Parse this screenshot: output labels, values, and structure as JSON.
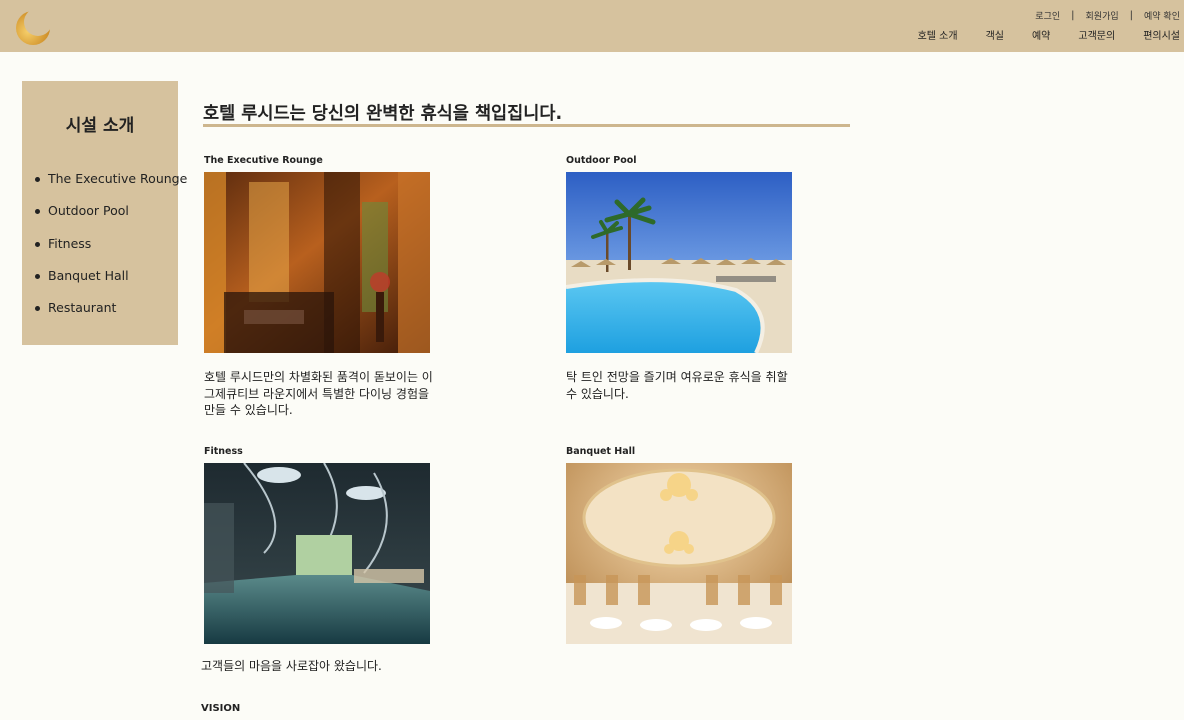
{
  "header": {
    "logo_icon": "crescent-moon-icon",
    "util_links": [
      "로그인",
      "회원가입",
      "예약 확인"
    ],
    "nav": [
      "호텔 소개",
      "객실",
      "예약",
      "고객문의",
      "편의시설"
    ]
  },
  "sidebar": {
    "title": "시설 소개",
    "items": [
      "The Executive Rounge",
      "Outdoor Pool",
      "Fitness",
      "Banquet Hall",
      "Restaurant"
    ]
  },
  "main": {
    "headline": "호텔 루시드는 당신의 완벽한 휴식을 책입집니다.",
    "cards": [
      {
        "title": "The Executive Rounge",
        "desc": "호텔 루시드만의 차별화된 품격이 돋보이는 이그제큐티브 라운지에서 특별한 다이닝 경험을 만들 수 있습니다."
      },
      {
        "title": "Outdoor Pool",
        "desc": "탁 트인 전망을 즐기며 여유로운 휴식을 취할 수 있습니다."
      },
      {
        "title": "Fitness",
        "desc": ""
      },
      {
        "title": "Banquet Hall",
        "desc": ""
      }
    ],
    "bottom_text": "고객들의 마음을 사로잡아 왔습니다.",
    "vision_label": "VISION"
  },
  "colors": {
    "header_bg": "#d6c29e",
    "page_bg": "#fcfcf7",
    "accent_line": "#cdb68e",
    "logo_moon": "#e0a43a"
  }
}
